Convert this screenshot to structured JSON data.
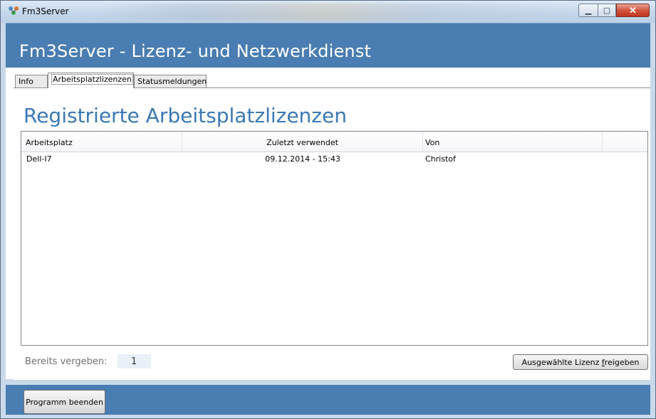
{
  "window": {
    "title": "Fm3Server",
    "icon": "network-users-icon"
  },
  "banner": {
    "title": "Fm3Server - Lizenz- und Netzwerkdienst"
  },
  "tabs": [
    {
      "label": "Info",
      "active": false
    },
    {
      "label": "Arbeitsplatzlizenzen",
      "active": true
    },
    {
      "label": "Statusmeldungen",
      "active": false
    }
  ],
  "section": {
    "heading": "Registrierte Arbeitsplatzlizenzen"
  },
  "table": {
    "columns": [
      "Arbeitsplatz",
      "Zuletzt verwendet",
      "Von",
      ""
    ],
    "rows": [
      [
        "Dell-I7",
        "09.12.2014 - 15:43",
        "Christof"
      ]
    ]
  },
  "footer": {
    "assigned_label": "Bereits vergeben:",
    "assigned_count": "1",
    "release_button": "Ausgewählte Lizenz freigeben",
    "release_mnemonic": "f"
  },
  "bottom": {
    "exit_button": "Programm beenden"
  },
  "colors": {
    "accent": "#4a7db1",
    "heading": "#3a78b5",
    "close": "#c0351e"
  }
}
